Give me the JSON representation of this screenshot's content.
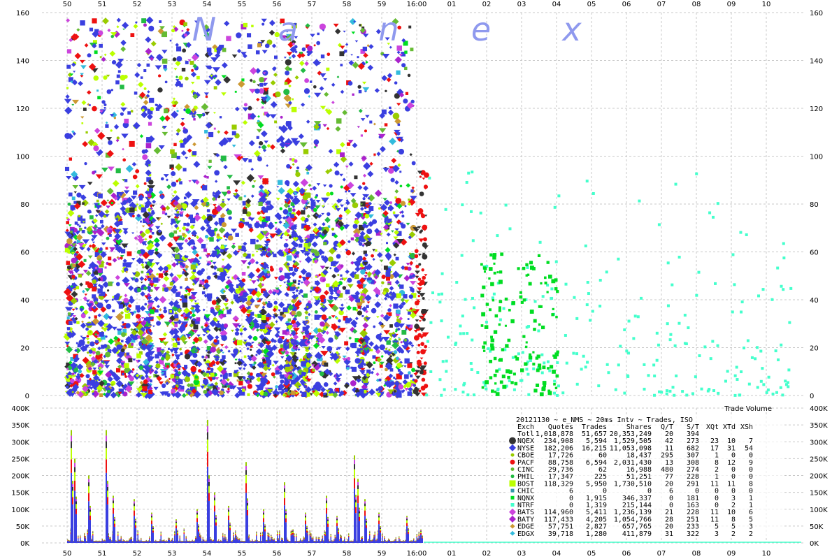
{
  "chart_data": [
    {
      "type": "scatter",
      "description_text": "",
      "title": "",
      "watermark": [
        "N",
        "a",
        "n",
        "e",
        "x"
      ],
      "xlabel": "",
      "ylabel": "",
      "x_ticks": [
        "50",
        "51",
        "52",
        "53",
        "54",
        "55",
        "56",
        "57",
        "58",
        "59",
        "16:00",
        "01",
        "02",
        "03",
        "04",
        "05",
        "06",
        "07",
        "08",
        "09",
        "10"
      ],
      "y_ticks": [
        "0",
        "20",
        "40",
        "60",
        "80",
        "100",
        "120",
        "140",
        "160"
      ],
      "ylim": [
        0,
        160
      ],
      "grid": true,
      "series_colors": {
        "NQEX": "#333333",
        "NYSE": "#3a3fe0",
        "CBOE": "#99cc00",
        "PACF": "#ee1111",
        "CINC": "#66bb33",
        "PHIL": "#22bb44",
        "BOST": "#bbff00",
        "CHIC": "#3399aa",
        "NQNX": "#00dd22",
        "NTRF": "#44ffcc",
        "BATS": "#cc44dd",
        "BATY": "#aa22cc",
        "EDGE": "#cc9933",
        "EDGX": "#33bbdd"
      }
    },
    {
      "type": "bar",
      "title": "Trade Volume",
      "y_ticks": [
        "0K",
        "50K",
        "100K",
        "150K",
        "200K",
        "250K",
        "300K",
        "350K",
        "400K"
      ],
      "ylim": [
        0,
        400000
      ],
      "x_ticks": [
        "50",
        "51",
        "52",
        "53",
        "54",
        "55",
        "56",
        "57",
        "58",
        "59",
        "16:00",
        "01",
        "02",
        "03",
        "04",
        "05",
        "06",
        "07",
        "08",
        "09",
        "10"
      ],
      "spikes": [
        {
          "x": 0.1,
          "value": 335000
        },
        {
          "x": 0.2,
          "value": 250000
        },
        {
          "x": 0.6,
          "value": 200000
        },
        {
          "x": 1.1,
          "value": 335000
        },
        {
          "x": 1.3,
          "value": 140000
        },
        {
          "x": 1.9,
          "value": 130000
        },
        {
          "x": 2.4,
          "value": 90000
        },
        {
          "x": 3.1,
          "value": 70000
        },
        {
          "x": 3.7,
          "value": 100000
        },
        {
          "x": 4.0,
          "value": 365000
        },
        {
          "x": 4.2,
          "value": 150000
        },
        {
          "x": 4.6,
          "value": 110000
        },
        {
          "x": 5.1,
          "value": 240000
        },
        {
          "x": 5.6,
          "value": 100000
        },
        {
          "x": 6.2,
          "value": 180000
        },
        {
          "x": 6.8,
          "value": 90000
        },
        {
          "x": 7.4,
          "value": 140000
        },
        {
          "x": 7.7,
          "value": 80000
        },
        {
          "x": 8.2,
          "value": 260000
        },
        {
          "x": 8.3,
          "value": 190000
        },
        {
          "x": 8.5,
          "value": 130000
        },
        {
          "x": 8.9,
          "value": 90000
        },
        {
          "x": 9.7,
          "value": 80000
        },
        {
          "x": 10.1,
          "value": 40000
        }
      ]
    }
  ],
  "table": {
    "heading": "20121130 ~ e_NMS ~ 20ms Intv ~ Trades, ISO",
    "columns": [
      "Exch",
      "Quotes",
      "Trades",
      "Shares",
      "Q/T",
      "S/T",
      "XQt",
      "XTd",
      "XSh"
    ],
    "rows": [
      {
        "exch": "Totl",
        "quotes": "1,018,878",
        "trades": "51,657",
        "shares": "20,353,249",
        "qt": "20",
        "st": "394",
        "xqt": "",
        "xtd": "",
        "xsh": "",
        "color": "",
        "marker": "none"
      },
      {
        "exch": "NQEX",
        "quotes": "234,908",
        "trades": "5,594",
        "shares": "1,529,505",
        "qt": "42",
        "st": "273",
        "xqt": "23",
        "xtd": "10",
        "xsh": "7",
        "color": "#333333",
        "marker": "octagon"
      },
      {
        "exch": "NYSE",
        "quotes": "182,206",
        "trades": "16,215",
        "shares": "11,053,098",
        "qt": "11",
        "st": "682",
        "xqt": "17",
        "xtd": "31",
        "xsh": "54",
        "color": "#3a3fe0",
        "marker": "diamond"
      },
      {
        "exch": "CBOE",
        "quotes": "17,726",
        "trades": "60",
        "shares": "18,437",
        "qt": "295",
        "st": "307",
        "xqt": "1",
        "xtd": "0",
        "xsh": "0",
        "color": "#99cc00",
        "marker": "circle-small"
      },
      {
        "exch": "PACF",
        "quotes": "88,758",
        "trades": "6,594",
        "shares": "2,031,430",
        "qt": "13",
        "st": "308",
        "xqt": "8",
        "xtd": "12",
        "xsh": "9",
        "color": "#ee1111",
        "marker": "circle"
      },
      {
        "exch": "CINC",
        "quotes": "29,736",
        "trades": "62",
        "shares": "16,988",
        "qt": "480",
        "st": "274",
        "xqt": "2",
        "xtd": "0",
        "xsh": "0",
        "color": "#66bb33",
        "marker": "circle-small"
      },
      {
        "exch": "PHIL",
        "quotes": "17,347",
        "trades": "225",
        "shares": "51,251",
        "qt": "77",
        "st": "228",
        "xqt": "1",
        "xtd": "0",
        "xsh": "0",
        "color": "#22bb44",
        "marker": "circle-small"
      },
      {
        "exch": "BOST",
        "quotes": "118,329",
        "trades": "5,950",
        "shares": "1,730,510",
        "qt": "20",
        "st": "291",
        "xqt": "11",
        "xtd": "11",
        "xsh": "8",
        "color": "#bbff00",
        "marker": "square"
      },
      {
        "exch": "CHIC",
        "quotes": "6",
        "trades": "0",
        "shares": "0",
        "qt": "6",
        "st": "0",
        "xqt": "0",
        "xtd": "0",
        "xsh": "0",
        "color": "#3399aa",
        "marker": "square-small"
      },
      {
        "exch": "NQNX",
        "quotes": "0",
        "trades": "1,915",
        "shares": "346,337",
        "qt": "0",
        "st": "181",
        "xqt": "0",
        "xtd": "3",
        "xsh": "1",
        "color": "#00dd22",
        "marker": "square-small"
      },
      {
        "exch": "NTRF",
        "quotes": "0",
        "trades": "1,319",
        "shares": "215,144",
        "qt": "0",
        "st": "163",
        "xqt": "0",
        "xtd": "2",
        "xsh": "1",
        "color": "#44ffcc",
        "marker": "square-small"
      },
      {
        "exch": "BATS",
        "quotes": "114,960",
        "trades": "5,411",
        "shares": "1,236,139",
        "qt": "21",
        "st": "228",
        "xqt": "11",
        "xtd": "10",
        "xsh": "6",
        "color": "#cc44dd",
        "marker": "diamond"
      },
      {
        "exch": "BATY",
        "quotes": "117,433",
        "trades": "4,205",
        "shares": "1,054,766",
        "qt": "28",
        "st": "251",
        "xqt": "11",
        "xtd": "8",
        "xsh": "5",
        "color": "#aa22cc",
        "marker": "diamond"
      },
      {
        "exch": "EDGE",
        "quotes": "57,751",
        "trades": "2,827",
        "shares": "657,765",
        "qt": "20",
        "st": "233",
        "xqt": "5",
        "xtd": "5",
        "xsh": "3",
        "color": "#cc9933",
        "marker": "diamond-small"
      },
      {
        "exch": "EDGX",
        "quotes": "39,718",
        "trades": "1,280",
        "shares": "411,879",
        "qt": "31",
        "st": "322",
        "xqt": "3",
        "xtd": "2",
        "xsh": "2",
        "color": "#33bbdd",
        "marker": "diamond-small"
      }
    ]
  }
}
